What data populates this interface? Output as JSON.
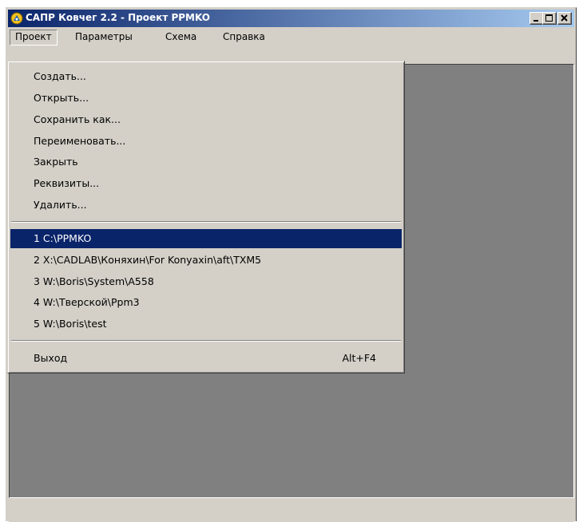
{
  "window": {
    "title": "САПР Ковчег 2.2 - Проект PPMKO",
    "icon": "app-logo-icon",
    "buttons": [
      "minimize-icon",
      "maximize-icon",
      "close-icon"
    ]
  },
  "menubar": {
    "items": [
      {
        "label": "Проект"
      },
      {
        "label": "Параметры"
      },
      {
        "label": "Схема"
      },
      {
        "label": "Справка"
      }
    ]
  },
  "menu": {
    "commands": [
      {
        "label": "Создать..."
      },
      {
        "label": "Открыть..."
      },
      {
        "label": "Сохранить как..."
      },
      {
        "label": "Переименовать..."
      },
      {
        "label": "Закрыть"
      },
      {
        "label": "Реквизиты..."
      },
      {
        "label": "Удалить..."
      }
    ],
    "recent": [
      {
        "label": "1 C:\\PPMKO"
      },
      {
        "label": "2 X:\\CADLAB\\Коняхин\\For Konyaxin\\aft\\TXM5"
      },
      {
        "label": "3 W:\\Boris\\System\\A558"
      },
      {
        "label": "4 W:\\Тверской\\Ppm3"
      },
      {
        "label": "5 W:\\Boris\\test"
      }
    ],
    "exit": {
      "label": "Выход",
      "shortcut": "Alt+F4"
    }
  },
  "colors": {
    "titlebar_start": "#0a246a",
    "titlebar_end": "#a6caf0",
    "face": "#d4d0c8",
    "workspace": "#808080",
    "selection": "#0a246a"
  }
}
